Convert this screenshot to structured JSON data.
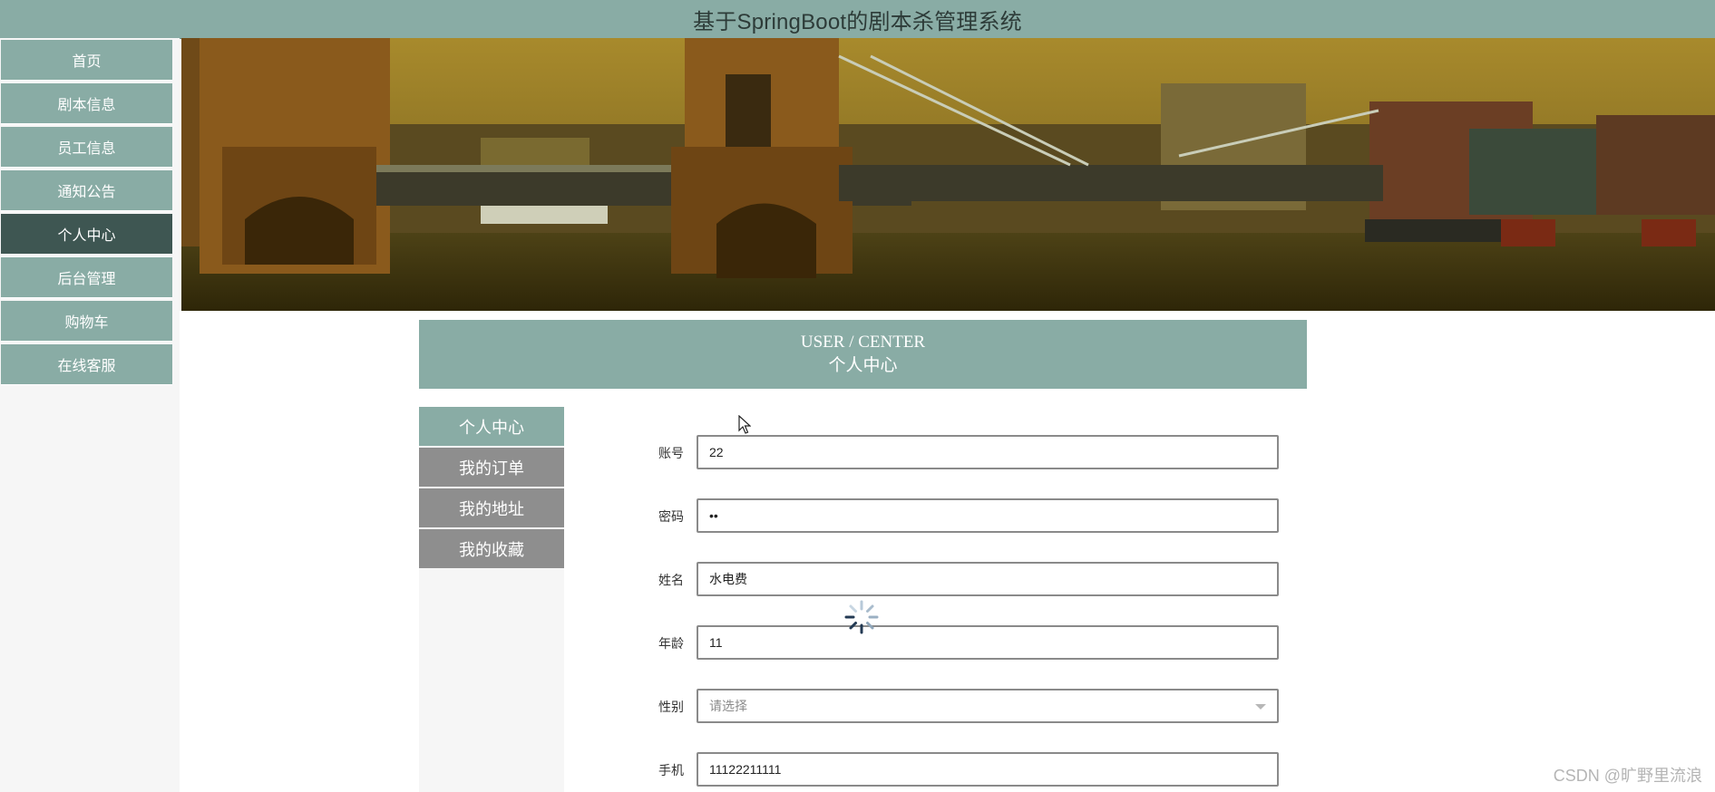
{
  "app": {
    "title": "基于SpringBoot的剧本杀管理系统"
  },
  "left_nav": {
    "items": [
      {
        "label": "首页",
        "active": false
      },
      {
        "label": "剧本信息",
        "active": false
      },
      {
        "label": "员工信息",
        "active": false
      },
      {
        "label": "通知公告",
        "active": false
      },
      {
        "label": "个人中心",
        "active": true
      },
      {
        "label": "后台管理",
        "active": false
      },
      {
        "label": "购物车",
        "active": false
      },
      {
        "label": "在线客服",
        "active": false
      }
    ]
  },
  "page_header": {
    "title_en": "USER / CENTER",
    "title_cn": "个人中心"
  },
  "sub_nav": {
    "items": [
      {
        "label": "个人中心",
        "active": true
      },
      {
        "label": "我的订单",
        "active": false
      },
      {
        "label": "我的地址",
        "active": false
      },
      {
        "label": "我的收藏",
        "active": false
      }
    ]
  },
  "form": {
    "account": {
      "label": "账号",
      "value": "22"
    },
    "password": {
      "label": "密码",
      "value": "••"
    },
    "name": {
      "label": "姓名",
      "value": "水电费"
    },
    "age": {
      "label": "年龄",
      "value": "11"
    },
    "gender": {
      "label": "性别",
      "placeholder": "请选择"
    },
    "phone": {
      "label": "手机",
      "value": "11122211111"
    }
  },
  "watermark": "CSDN @旷野里流浪",
  "icons": {
    "cursor": "mouse-pointer-icon",
    "loading": "loading-spinner-icon",
    "select_caret": "chevron-down-icon"
  },
  "colors": {
    "accent": "#89aca5",
    "active_nav": "#3e5652",
    "subnav_inactive": "#8e8e8e"
  }
}
